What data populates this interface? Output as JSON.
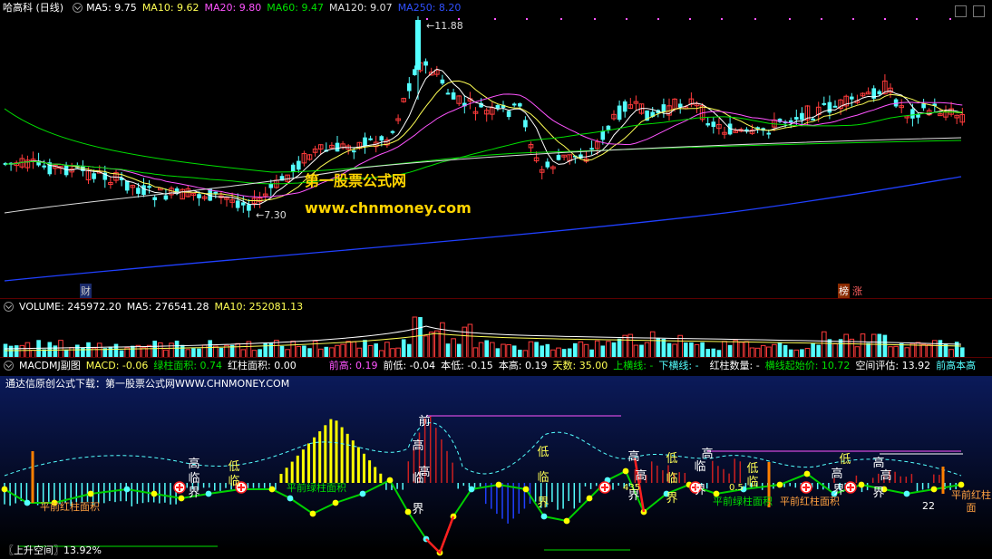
{
  "price": {
    "title": "哈高科 (日线)",
    "ma5": "MA5: 9.75",
    "ma10": "MA10: 9.62",
    "ma20": "MA20: 9.80",
    "ma60": "MA60: 9.47",
    "ma120": "MA120: 9.07",
    "ma250": "MA250: 8.20",
    "high_label": "←11.88",
    "low_label": "←7.30",
    "watermark1": "第一股票公式网",
    "watermark2": "www.chnmoney.com",
    "bottom_tag_left": "财",
    "bottom_tag_right1": "榜",
    "bottom_tag_right2": "涨"
  },
  "colors": {
    "up": "#ff3b3b",
    "down": "#54ffff",
    "ma5": "#ffffff",
    "ma10": "#ffff54",
    "ma20": "#ff54ff",
    "ma60": "#00e000",
    "ma120": "#e0e0e0",
    "ma250": "#2040ff"
  },
  "volume": {
    "label": "VOLUME: 245972.20",
    "ma5": "MA5: 276541.28",
    "ma10": "MA10: 252081.13"
  },
  "macd": {
    "name": "MACDMJ副图",
    "macd": "MACD: -0.06",
    "green_area": "绿柱面积: 0.74",
    "red_area": "红柱面积: 0.00",
    "prev_high": "前高: 0.19",
    "prev_low": "前低: -0.04",
    "this_low": "本低: -0.15",
    "this_high": "本高: 0.19",
    "days": "天数: 35.00",
    "up_line": "上横线: -",
    "down_line": "下横线: -",
    "red_count": "红柱数量: -",
    "line_start_price": "横线起始价: 10.72",
    "space_eval": "空间评估: 13.92",
    "trail": "前高本高",
    "subtitle": "通达信原创公式下载：第一股票公式网WWW.CHNMONEY.COM",
    "rise_space": "〖上升空间〗13.92%",
    "labels": {
      "ping_red": "平前红柱面积",
      "ping_green": "平前绿柱面积",
      "ping_red2": "平前红柱面积",
      "gao": "高",
      "lin": "临",
      "jie": "界",
      "di": "低",
      "qian": "前",
      "ping_green2": "平前绿柱面积",
      "ping_red3": "平前红柱面",
      "v_05": "0.5",
      "v_22": "22",
      "v_435": "435"
    }
  }
}
